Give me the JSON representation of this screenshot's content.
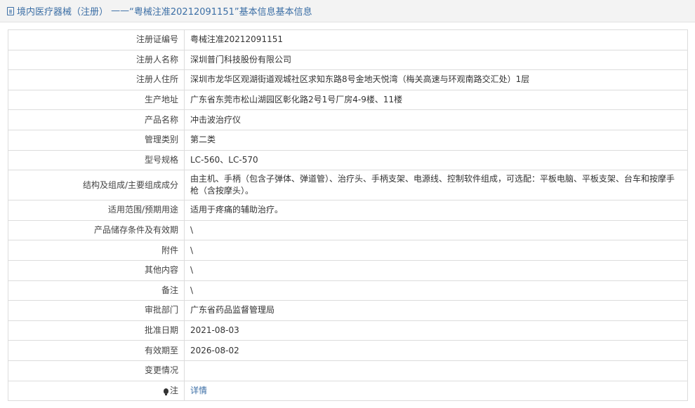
{
  "header": {
    "category": "境内医疗器械（注册）",
    "dash": "——",
    "title": "“粤械注准20212091151”基本信息"
  },
  "rows": [
    {
      "label": "注册证编号",
      "value": "粤械注准20212091151"
    },
    {
      "label": "注册人名称",
      "value": "深圳普门科技股份有限公司"
    },
    {
      "label": "注册人住所",
      "value": "深圳市龙华区观湖街道观城社区求知东路8号金地天悦湾（梅关高速与环观南路交汇处）1层"
    },
    {
      "label": "生产地址",
      "value": "广东省东莞市松山湖园区彰化路2号1号厂房4-9楼、11楼"
    },
    {
      "label": "产品名称",
      "value": "冲击波治疗仪"
    },
    {
      "label": "管理类别",
      "value": "第二类"
    },
    {
      "label": "型号规格",
      "value": "LC-560、LC-570"
    },
    {
      "label": "结构及组成/主要组成成分",
      "value": "由主机、手柄（包含子弹体、弹道管）、治疗头、手柄支架、电源线、控制软件组成，可选配：平板电脑、平板支架、台车和按摩手枪（含按摩头）。"
    },
    {
      "label": "适用范围/预期用途",
      "value": "适用于疼痛的辅助治疗。"
    },
    {
      "label": "产品储存条件及有效期",
      "value": "\\"
    },
    {
      "label": "附件",
      "value": "\\"
    },
    {
      "label": "其他内容",
      "value": "\\"
    },
    {
      "label": "备注",
      "value": "\\"
    },
    {
      "label": "审批部门",
      "value": "广东省药品监督管理局"
    },
    {
      "label": "批准日期",
      "value": "2021-08-03"
    },
    {
      "label": "有效期至",
      "value": "2026-08-02"
    },
    {
      "label": "变更情况",
      "value": ""
    },
    {
      "label": "注",
      "value": "详情",
      "icon": "lightbulb-icon"
    }
  ]
}
